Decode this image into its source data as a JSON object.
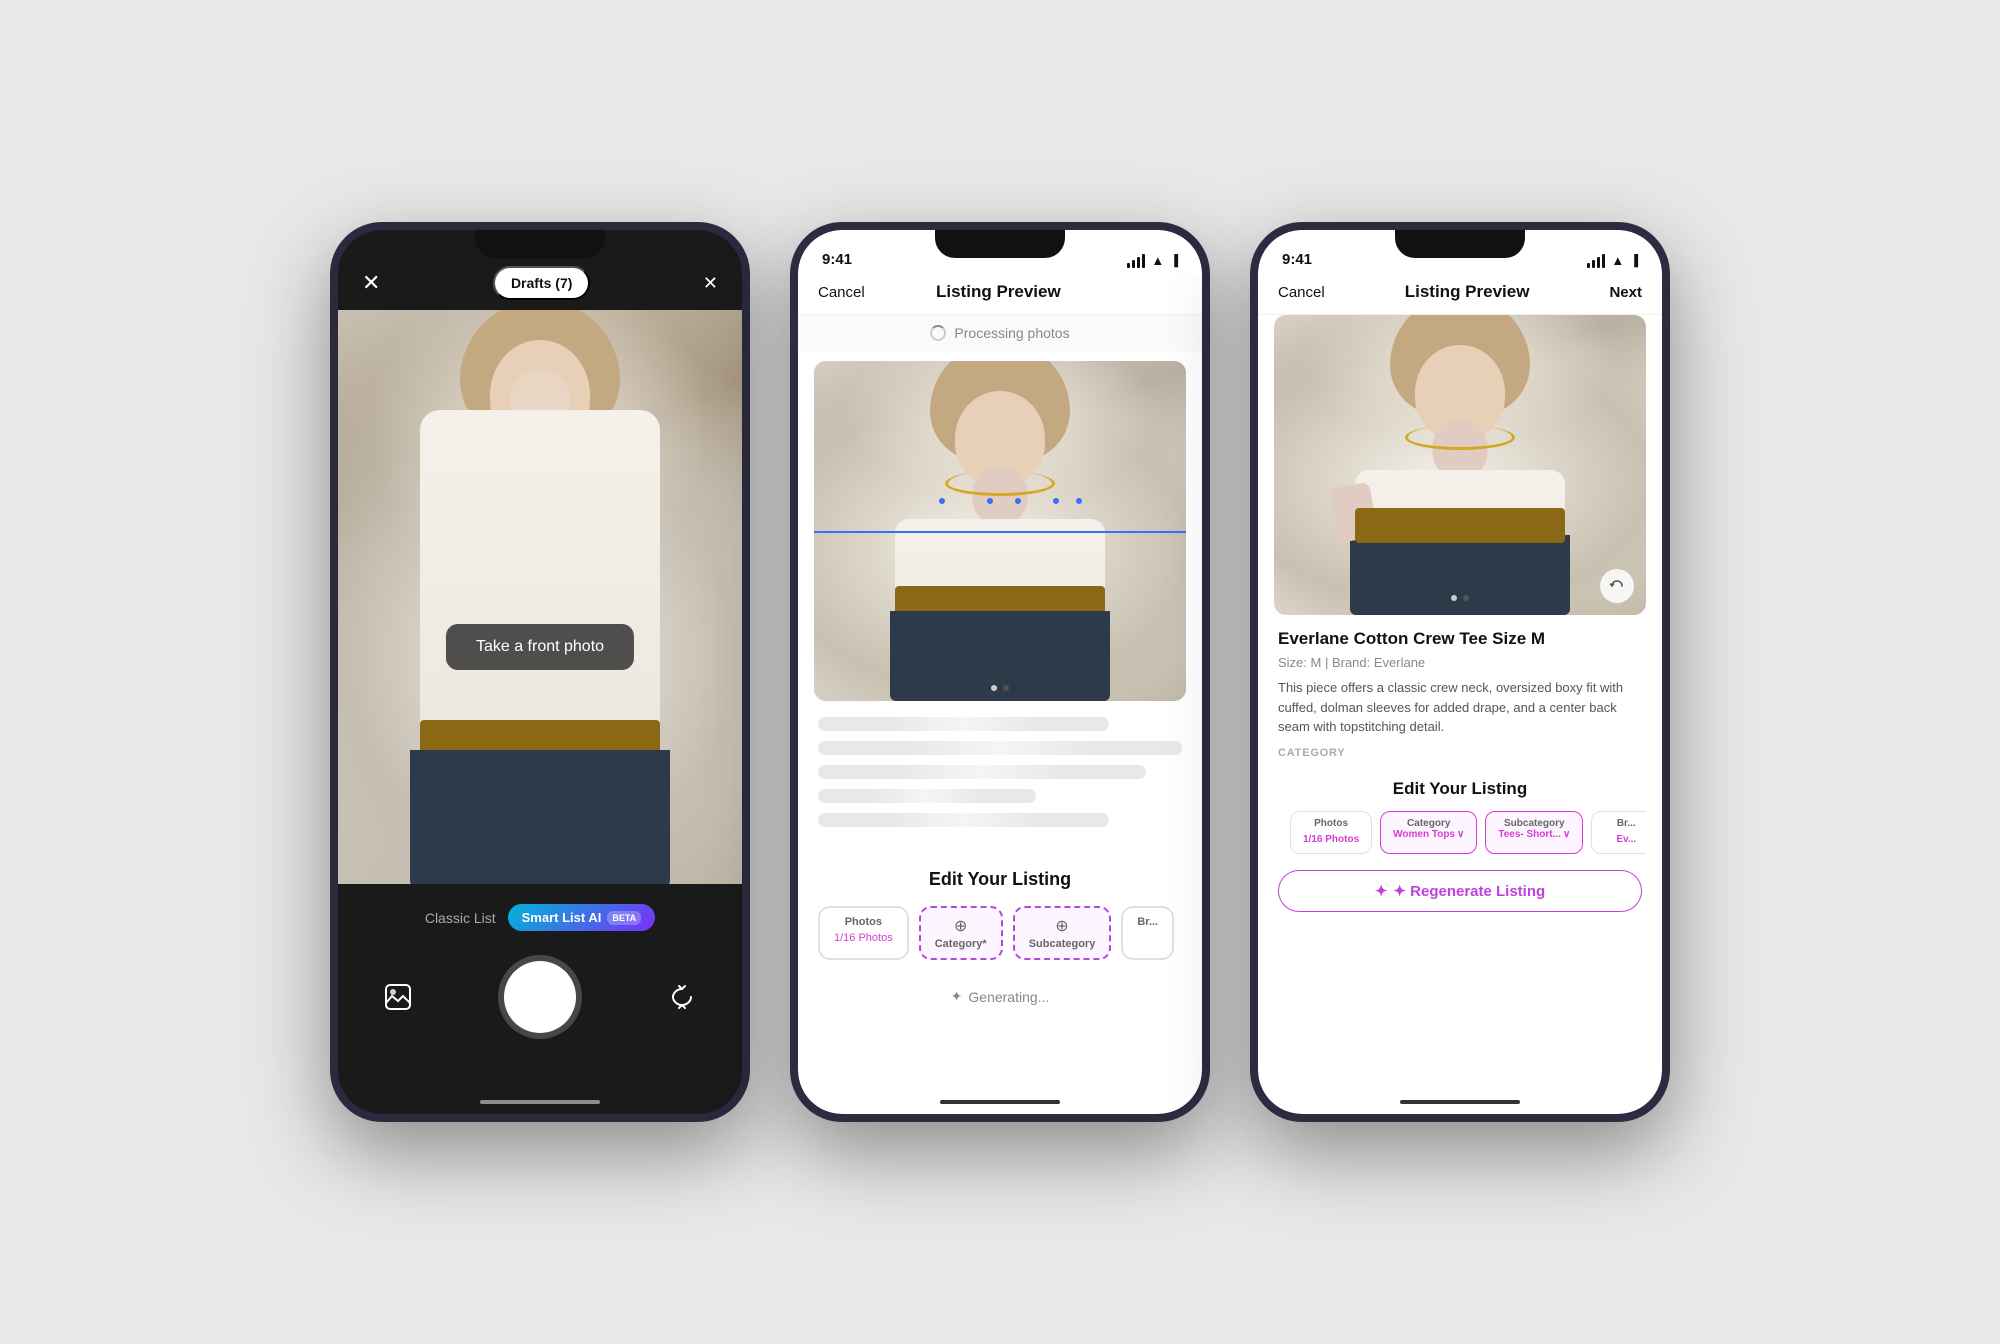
{
  "phone1": {
    "top_left_icon": "✕",
    "drafts_label": "Drafts (7)",
    "cross_icon": "✕",
    "photo_prompt": "Take a front photo",
    "mode_classic": "Classic List",
    "mode_smart": "Smart List AI",
    "beta": "BETA",
    "shutter_label": "Shutter",
    "gallery_icon": "🖼",
    "flip_icon": "⟳"
  },
  "phone2": {
    "time": "9:41",
    "cancel": "Cancel",
    "title": "Listing Preview",
    "processing": "Processing photos",
    "edit_title": "Edit Your Listing",
    "tab_photos_label": "Photos",
    "tab_photos_sub": "1/16 Photos",
    "tab_category_label": "Category*",
    "tab_subcategory_label": "Subcategory",
    "tab_brand_label": "Br...",
    "generating": "Generating..."
  },
  "phone3": {
    "time": "9:41",
    "cancel": "Cancel",
    "title": "Listing Preview",
    "next": "Next",
    "listing_title": "Everlane Cotton Crew Tee Size M",
    "listing_meta": "Size: M  |  Brand: Everlane",
    "listing_desc": "This piece offers a classic crew neck, oversized boxy fit with cuffed, dolman sleeves for added drape, and a center back seam with topstitching detail.",
    "category_label": "CATEGORY",
    "edit_title": "Edit Your Listing",
    "tab_photos_label": "Photos",
    "tab_photos_sub": "1/16 Photos",
    "tab_category_label": "Category",
    "tab_category_sub": "Women Tops",
    "tab_subcategory_label": "Subcategory",
    "tab_subcategory_sub": "Tees- Short...",
    "tab_brand_label": "Br...",
    "tab_brand_sub": "Ev...",
    "regenerate_label": "✦ Regenerate Listing"
  }
}
